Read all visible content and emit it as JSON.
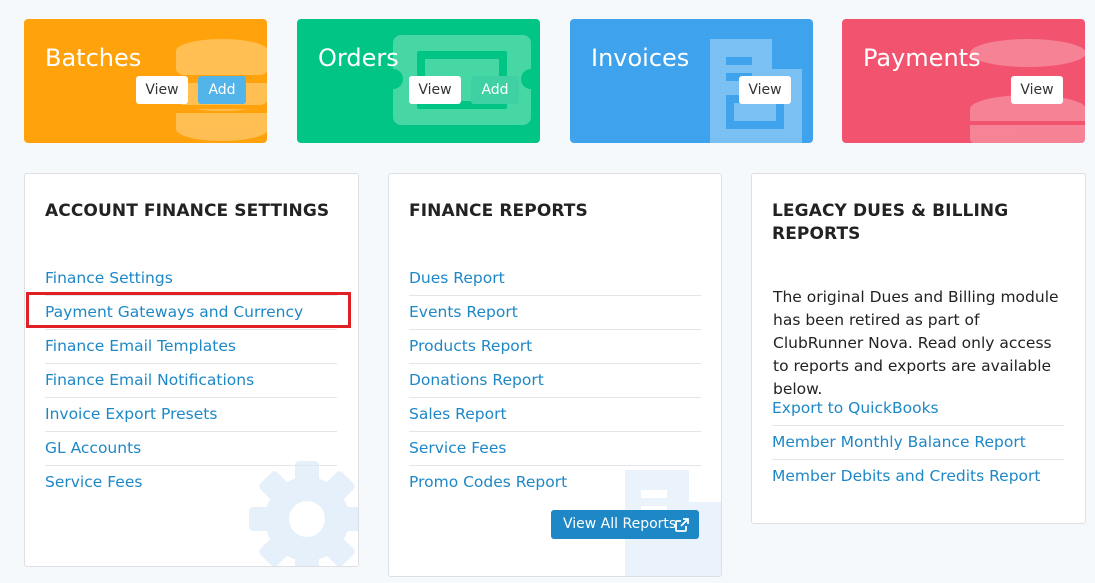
{
  "tiles": [
    {
      "title": "Batches",
      "view_label": "View",
      "add_label": "Add",
      "color": "#ffa20c"
    },
    {
      "title": "Orders",
      "view_label": "View",
      "add_label": "Add",
      "color": "#00c584"
    },
    {
      "title": "Invoices",
      "view_label": "View",
      "color": "#3fa2ec"
    },
    {
      "title": "Payments",
      "view_label": "View",
      "color": "#f2536e"
    }
  ],
  "account_finance": {
    "heading": "ACCOUNT FINANCE SETTINGS",
    "links": [
      "Finance Settings",
      "Payment Gateways and Currency",
      "Finance Email Templates",
      "Finance Email Notifications",
      "Invoice Export Presets",
      "GL Accounts",
      "Service Fees"
    ]
  },
  "finance_reports": {
    "heading": "FINANCE REPORTS",
    "links": [
      "Dues Report",
      "Events Report",
      "Products Report",
      "Donations Report",
      "Sales Report",
      "Service Fees",
      "Promo Codes Report"
    ],
    "view_all_label": "View All Reports"
  },
  "legacy": {
    "heading": "LEGACY DUES & BILLING REPORTS",
    "description": "The original Dues and Billing module has been retired as part of ClubRunner Nova. Read only access to reports and exports are available below.",
    "links": [
      "Export to QuickBooks",
      "Member Monthly Balance Report",
      "Member Debits and Credits Report"
    ]
  },
  "colors": {
    "link": "#1e88c7",
    "highlight": "#e02025"
  }
}
